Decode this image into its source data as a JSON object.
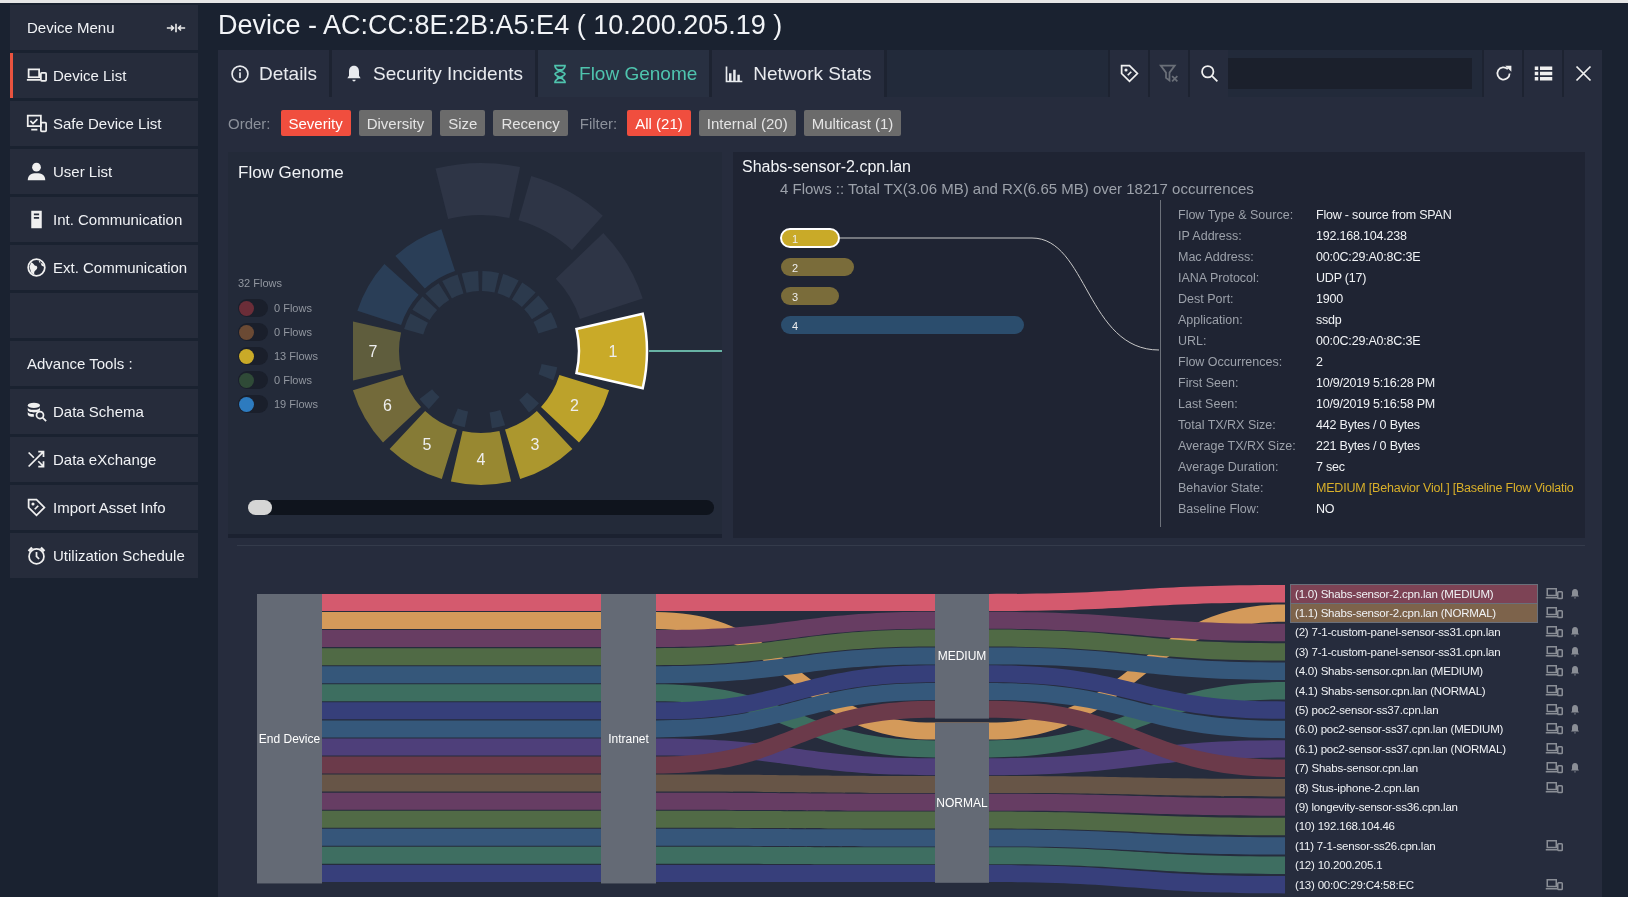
{
  "sidebar": {
    "header": "Device Menu",
    "items": [
      {
        "label": "Device List",
        "selected": true
      },
      {
        "label": "Safe Device List",
        "selected": false
      },
      {
        "label": "User List",
        "selected": false
      },
      {
        "label": "Int. Communication",
        "selected": false
      },
      {
        "label": "Ext. Communication",
        "selected": false
      }
    ],
    "section": "Advance Tools :",
    "tools": [
      {
        "label": "Data Schema",
        "selected": false
      },
      {
        "label": "Data eXchange",
        "selected": false
      },
      {
        "label": "Import Asset Info",
        "selected": false
      },
      {
        "label": "Utilization Schedule",
        "selected": false
      }
    ]
  },
  "title": "Device - AC:CC:8E:2B:A5:E4 ( 10.200.205.19 )",
  "tabs": [
    {
      "label": "Details",
      "selected": false
    },
    {
      "label": "Security Incidents",
      "selected": false
    },
    {
      "label": "Flow Genome",
      "selected": true
    },
    {
      "label": "Network Stats",
      "selected": false
    }
  ],
  "toolbar": [
    {
      "disabled": false
    },
    {
      "disabled": true
    },
    {
      "disabled": false
    },
    {
      "disabled": false
    },
    {
      "disabled": false
    },
    {
      "disabled": false
    }
  ],
  "order": {
    "label": "Order:",
    "options": [
      {
        "label": "Severity",
        "selected": true
      },
      {
        "label": "Diversity",
        "selected": false
      },
      {
        "label": "Size",
        "selected": false
      },
      {
        "label": "Recency",
        "selected": false
      }
    ]
  },
  "filter": {
    "label": "Filter:",
    "options": [
      {
        "label": "All (21)",
        "selected": true
      },
      {
        "label": "Internal (20)",
        "selected": false
      },
      {
        "label": "Multicast (1)",
        "selected": false
      }
    ]
  },
  "genome": {
    "title": "Flow Genome",
    "total": "32 Flows",
    "legend": [
      {
        "label": "0 Flows",
        "color": "#6b2d38"
      },
      {
        "label": "0 Flows",
        "color": "#6b4a34"
      },
      {
        "label": "13 Flows",
        "color": "#c9aa28"
      },
      {
        "label": "0 Flows",
        "color": "#2f4a37"
      },
      {
        "label": "19 Flows",
        "color": "#2d7bbf"
      }
    ],
    "segments": [
      {
        "label": "1",
        "color": "#c9aa28",
        "selected": true
      },
      {
        "label": "2",
        "color": "#bca22b",
        "selected": false
      },
      {
        "label": "3",
        "color": "#ac972e",
        "selected": false
      },
      {
        "label": "4",
        "color": "#988831",
        "selected": false
      },
      {
        "label": "5",
        "color": "#867b36",
        "selected": false
      },
      {
        "label": "6",
        "color": "#736a3a",
        "selected": false
      },
      {
        "label": "7",
        "color": "#5f5d3d",
        "selected": false
      }
    ],
    "slider": {
      "level": 0
    }
  },
  "details": {
    "title": "Shabs-sensor-2.cpn.lan",
    "summary": "4 Flows :: Total TX(3.06 MB) and RX(6.65 MB) over 18217 occurrences",
    "flows": [
      {
        "label": "1",
        "color": "#c9aa28",
        "selected": true
      },
      {
        "label": "2",
        "color": "#7a6c3a",
        "selected": false
      },
      {
        "label": "3",
        "color": "#7a6c3a",
        "selected": false
      },
      {
        "label": "4",
        "color": "#2b4d6d",
        "selected": false
      }
    ],
    "fields": [
      {
        "label": "Flow Type & Source:",
        "value": "Flow - source from SPAN",
        "kind": "plain"
      },
      {
        "label": "IP Address:",
        "value": "192.168.104.238",
        "kind": "plain"
      },
      {
        "label": "Mac Address:",
        "value": "00:0C:29:A0:8C:3E",
        "kind": "plain"
      },
      {
        "label": "IANA Protocol:",
        "value": "UDP (17)",
        "kind": "plain"
      },
      {
        "label": "Dest Port:",
        "value": "1900",
        "kind": "plain"
      },
      {
        "label": "Application:",
        "value": "ssdp",
        "kind": "plain"
      },
      {
        "label": "URL:",
        "value": "00:0C:29:A0:8C:3E",
        "kind": "plain"
      },
      {
        "label": "Flow Occurrences:",
        "value": "2",
        "kind": "plain"
      },
      {
        "label": "First Seen:",
        "value": "10/9/2019 5:16:28 PM",
        "kind": "plain"
      },
      {
        "label": "Last Seen:",
        "value": "10/9/2019 5:16:58 PM",
        "kind": "plain"
      },
      {
        "label": "Total TX/RX Size:",
        "value": "442 Bytes / 0 Bytes",
        "kind": "plain"
      },
      {
        "label": "Average TX/RX Size:",
        "value": "221 Bytes / 0 Bytes",
        "kind": "plain"
      },
      {
        "label": "Average Duration:",
        "value": "7 sec",
        "kind": "plain"
      },
      {
        "label": "Behavior State:",
        "value": "MEDIUM [Behavior Viol.] [Baseline Flow Violatio",
        "kind": "warning"
      },
      {
        "label": "Baseline Flow:",
        "value": "NO",
        "kind": "plain"
      }
    ]
  },
  "sankey": {
    "nodes": [
      {
        "label": "End Device",
        "kind": "source"
      },
      {
        "label": "Intranet",
        "kind": "hop"
      },
      {
        "label": "MEDIUM",
        "kind": "medium"
      },
      {
        "label": "NORMAL",
        "kind": "normal"
      }
    ],
    "devices": [
      {
        "label": "(1.0) Shabs-sensor-2.cpn.lan (MEDIUM)",
        "color": "#d45a6e",
        "kind": "medium",
        "highlighted": true,
        "device_icon": true,
        "alert": true
      },
      {
        "label": "(1.1) Shabs-sensor-2.cpn.lan (NORMAL)",
        "color": "#d49a5a",
        "kind": "normal",
        "highlighted": true,
        "device_icon": true,
        "alert": false
      },
      {
        "label": "(2) 7-1-custom-panel-sensor-ss31.cpn.lan",
        "color": "#673d62",
        "kind": "medium",
        "highlighted": false,
        "device_icon": true,
        "alert": true
      },
      {
        "label": "(3) 7-1-custom-panel-sensor-ss31.cpn.lan",
        "color": "#506a45",
        "kind": "medium",
        "highlighted": false,
        "device_icon": true,
        "alert": true
      },
      {
        "label": "(4.0) Shabs-sensor.cpn.lan (MEDIUM)",
        "color": "#35577a",
        "kind": "medium",
        "highlighted": false,
        "device_icon": true,
        "alert": true
      },
      {
        "label": "(4.1) Shabs-sensor.cpn.lan (NORMAL)",
        "color": "#3d6e60",
        "kind": "normal",
        "highlighted": false,
        "device_icon": true,
        "alert": false
      },
      {
        "label": "(5) poc2-sensor-ss37.cpn.lan",
        "color": "#363f7a",
        "kind": "medium",
        "highlighted": false,
        "device_icon": true,
        "alert": true
      },
      {
        "label": "(6.0) poc2-sensor-ss37.cpn.lan (MEDIUM)",
        "color": "#35587b",
        "kind": "medium",
        "highlighted": false,
        "device_icon": true,
        "alert": true
      },
      {
        "label": "(6.1) poc2-sensor-ss37.cpn.lan (NORMAL)",
        "color": "#4e3f7a",
        "kind": "normal",
        "highlighted": false,
        "device_icon": true,
        "alert": false
      },
      {
        "label": "(7) Shabs-sensor.cpn.lan",
        "color": "#6b3a4a",
        "kind": "medium",
        "highlighted": false,
        "device_icon": true,
        "alert": true
      },
      {
        "label": "(8) Stus-iphone-2.cpn.lan",
        "color": "#675547",
        "kind": "normal",
        "highlighted": false,
        "device_icon": true,
        "alert": false
      },
      {
        "label": "(9) longevity-sensor-ss36.cpn.lan",
        "color": "#663d63",
        "kind": "normal",
        "highlighted": false,
        "device_icon": false,
        "alert": false
      },
      {
        "label": "(10) 192.168.104.46",
        "color": "#516a46",
        "kind": "normal",
        "highlighted": false,
        "device_icon": false,
        "alert": false
      },
      {
        "label": "(11) 7-1-sensor-ss26.cpn.lan",
        "color": "#36567a",
        "kind": "normal",
        "highlighted": false,
        "device_icon": true,
        "alert": false
      },
      {
        "label": "(12) 10.200.205.1",
        "color": "#3e6e61",
        "kind": "normal",
        "highlighted": false,
        "device_icon": false,
        "alert": false
      },
      {
        "label": "(13) 00:0C:29:C4:58:EC",
        "color": "#373f7b",
        "kind": "normal",
        "highlighted": false,
        "device_icon": true,
        "alert": false
      }
    ]
  }
}
